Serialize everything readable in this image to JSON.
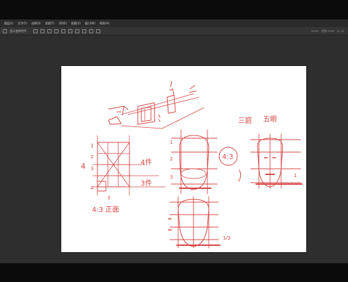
{
  "menu": [
    "图层(L)",
    "文字(Y)",
    "选择(S)",
    "滤镜(T)",
    "3D(D)",
    "视图(V)",
    "窗口(W)",
    "帮助(H)"
  ],
  "toolbar": {
    "align_label": "显示变换控件"
  },
  "status": {
    "zoom": "100%",
    "info": "文档:3.9M",
    "position": "(0, 0)"
  },
  "sketch_text": {
    "ratio_43": "4:3",
    "face_three": "三庭",
    "face_five": "五眼",
    "grid_num_1": "1",
    "grid_num_2": "2",
    "grid_num_3": "3",
    "grid_num_4": "4",
    "label_4a": "4",
    "label_4b": "4",
    "label_4_side": "4件",
    "label_3_side": "3件",
    "bottom_3": "3",
    "fraction": "1/3",
    "bottom_caption": "4:3 正面"
  },
  "colors": {
    "ink": "#d84a4a",
    "canvas": "#ffffff",
    "workspace": "#2e2e2e"
  }
}
